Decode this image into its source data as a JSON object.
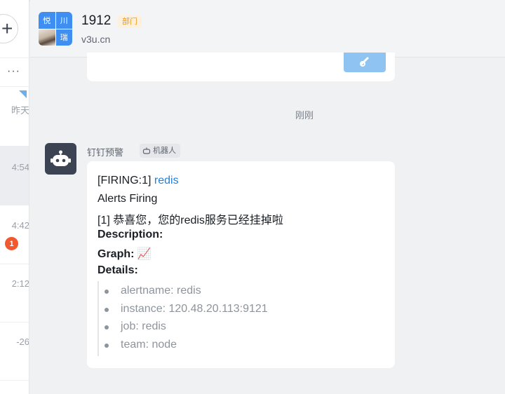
{
  "sidebar": {
    "plus_label": "+",
    "more_label": "···",
    "conversations": [
      {
        "time": "昨天",
        "selected": false,
        "flag": true
      },
      {
        "time": "4:54",
        "selected": true
      },
      {
        "time": "4:42",
        "unread": "1"
      },
      {
        "time": "2:12"
      },
      {
        "time": "-26"
      }
    ]
  },
  "header": {
    "avatar_cells": [
      "悦",
      "川",
      "瑞"
    ],
    "title": "1912",
    "badge": "部门",
    "subtitle": "v3u.cn"
  },
  "divider_time": "刚刚",
  "message": {
    "sender": "钉钉预警",
    "sender_tag": "机器人",
    "lines": {
      "firing_prefix": "[FIRING:1]",
      "firing_link": "redis",
      "alerts": "Alerts Firing",
      "summary": "[1] 恭喜您，您的redis服务已经挂掉啦",
      "description": "Description:",
      "graph": "Graph:",
      "graph_emoji": "📈",
      "details": "Details:"
    },
    "detail_items": [
      "alertname: redis",
      "instance: 120.48.20.113:9121",
      "job: redis",
      "team: node"
    ]
  },
  "colors": {
    "accent": "#1f82d6",
    "badge_bg": "#fdf0dc",
    "badge_text": "#f29a1b",
    "unread": "#f1582e"
  }
}
